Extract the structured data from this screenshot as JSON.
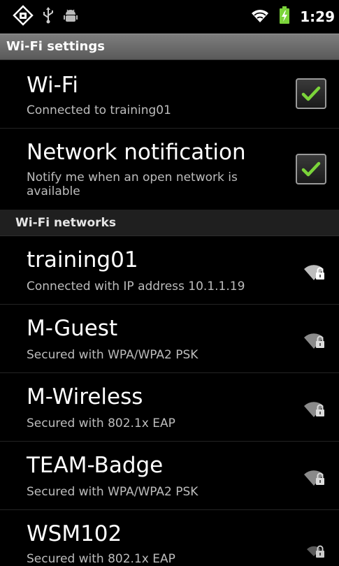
{
  "status_bar": {
    "time": "1:29",
    "icons": [
      "usb-debugging-icon",
      "usb-icon",
      "android-debug-icon",
      "wifi-icon",
      "battery-charging-icon"
    ],
    "accent_green": "#7bd43a"
  },
  "header": {
    "title": "Wi-Fi settings"
  },
  "settings": [
    {
      "title": "Wi-Fi",
      "subtitle": "Connected to training01",
      "checked": true
    },
    {
      "title": "Network notification",
      "subtitle": "Notify me when an open network is available",
      "checked": true
    }
  ],
  "section": {
    "title": "Wi-Fi networks"
  },
  "networks": [
    {
      "ssid": "training01",
      "status": "Connected with IP address 10.1.1.19",
      "icon": "wifi-locked-icon"
    },
    {
      "ssid": "M-Guest",
      "status": "Secured with WPA/WPA2 PSK",
      "icon": "wifi-locked-icon"
    },
    {
      "ssid": "M-Wireless",
      "status": "Secured with 802.1x EAP",
      "icon": "wifi-locked-icon"
    },
    {
      "ssid": "TEAM-Badge",
      "status": "Secured with WPA/WPA2 PSK",
      "icon": "wifi-locked-icon"
    },
    {
      "ssid": "WSM102",
      "status": "Secured with 802.1x EAP",
      "icon": "wifi-locked-icon"
    }
  ]
}
